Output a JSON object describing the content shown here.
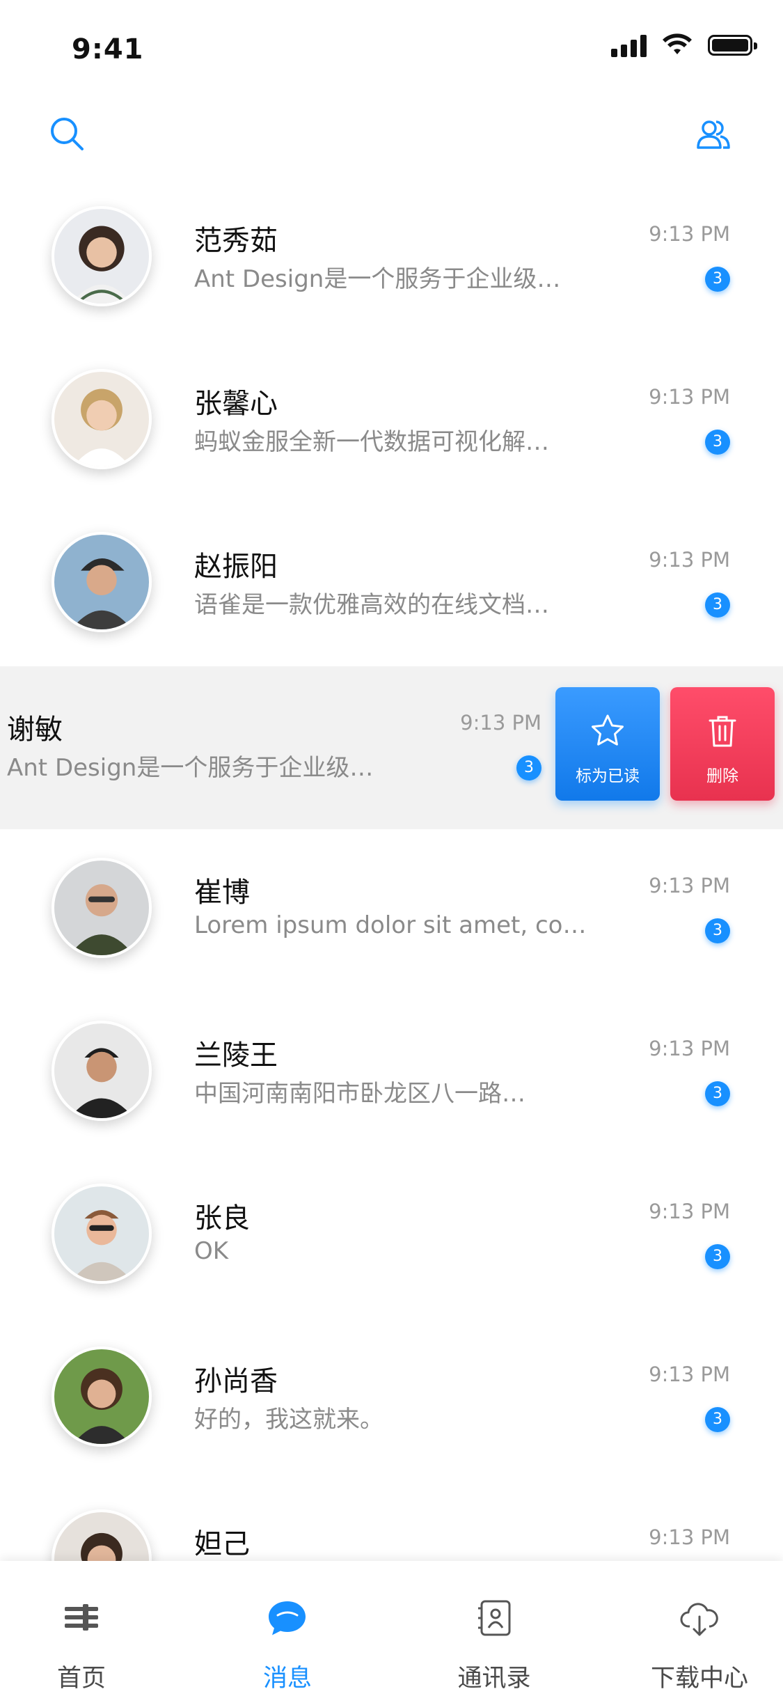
{
  "status_bar": {
    "time": "9:41"
  },
  "colors": {
    "accent": "#1890ff",
    "delete": "#e8324f",
    "swiped_bg": "#f2f2f2"
  },
  "toolbar": {
    "search_icon": "search-icon",
    "group_icon": "contacts-group-icon"
  },
  "messages": [
    {
      "name": "范秀茹",
      "preview": "Ant Design是一个服务于企业级…",
      "time": "9:13 PM",
      "unread": "3"
    },
    {
      "name": "张馨心",
      "preview": "蚂蚁金服全新一代数据可视化解…",
      "time": "9:13 PM",
      "unread": "3"
    },
    {
      "name": "赵振阳",
      "preview": "语雀是一款优雅高效的在线文档…",
      "time": "9:13 PM",
      "unread": "3"
    },
    {
      "name": "谢敏",
      "preview": "Ant Design是一个服务于企业级…",
      "time": "9:13 PM",
      "unread": "3"
    },
    {
      "name": "崔博",
      "preview": "Lorem ipsum dolor sit amet, co…",
      "time": "9:13 PM",
      "unread": "3"
    },
    {
      "name": "兰陵王",
      "preview": "中国河南南阳市卧龙区八一路…",
      "time": "9:13 PM",
      "unread": "3"
    },
    {
      "name": "张良",
      "preview": "OK",
      "time": "9:13 PM",
      "unread": "3"
    },
    {
      "name": "孙尚香",
      "preview": "好的，我这就来。",
      "time": "9:13 PM",
      "unread": "3"
    },
    {
      "name": "妲己",
      "preview": "",
      "time": "9:13 PM",
      "unread": ""
    }
  ],
  "swipe_actions": {
    "mark_read": "标为已读",
    "delete": "删除"
  },
  "tabs": [
    {
      "label": "首页",
      "icon": "home-icon",
      "active": false
    },
    {
      "label": "消息",
      "icon": "chat-bubble-icon",
      "active": true
    },
    {
      "label": "通讯录",
      "icon": "address-book-icon",
      "active": false
    },
    {
      "label": "下载中心",
      "icon": "cloud-download-icon",
      "active": false
    }
  ]
}
